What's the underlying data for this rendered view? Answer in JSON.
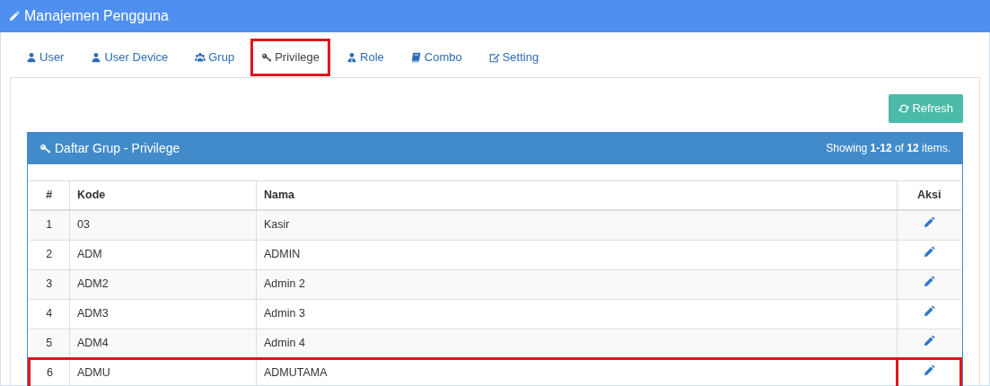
{
  "header": {
    "title": "Manajemen Pengguna"
  },
  "tabs": [
    {
      "label": "User",
      "kind": "user",
      "selected": false
    },
    {
      "label": "User Device",
      "kind": "user",
      "selected": false
    },
    {
      "label": "Grup",
      "kind": "users",
      "selected": false
    },
    {
      "label": "Privilege",
      "kind": "key",
      "selected": true
    },
    {
      "label": "Role",
      "kind": "role",
      "selected": false
    },
    {
      "label": "Combo",
      "kind": "book",
      "selected": false
    },
    {
      "label": "Setting",
      "kind": "edit",
      "selected": false
    }
  ],
  "refresh_button": {
    "label": "Refresh"
  },
  "panel": {
    "title": "Daftar Grup - Privilege",
    "summary": "Showing **1-12** of **12** items."
  },
  "table": {
    "columns": [
      "#",
      "Kode",
      "Nama",
      "Aksi"
    ],
    "rows": [
      {
        "no": "1",
        "kode": "03",
        "nama": "Kasir",
        "highlighted": false
      },
      {
        "no": "2",
        "kode": "ADM",
        "nama": "ADMIN",
        "highlighted": false
      },
      {
        "no": "3",
        "kode": "ADM2",
        "nama": "Admin 2",
        "highlighted": false
      },
      {
        "no": "4",
        "kode": "ADM3",
        "nama": "Admin 3",
        "highlighted": false
      },
      {
        "no": "5",
        "kode": "ADM4",
        "nama": "Admin 4",
        "highlighted": false
      },
      {
        "no": "6",
        "kode": "ADMU",
        "nama": "ADMUTAMA",
        "highlighted": true
      }
    ]
  }
}
